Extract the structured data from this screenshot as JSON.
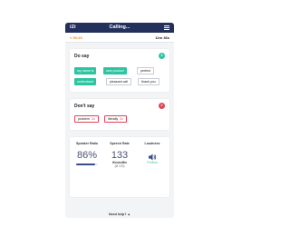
{
  "header": {
    "logo": "i2i",
    "title": "Calling...",
    "menu_icon": "hamburger-icon"
  },
  "subheader": {
    "back_label": "< 00:23",
    "duration": "12m 36s"
  },
  "do_say": {
    "title": "Do say",
    "count": "3",
    "count_color": "#2ec4a0",
    "chips": [
      {
        "label": "my name is",
        "state": "used"
      },
      {
        "label": "new product",
        "state": "used"
      },
      {
        "label": "perfect",
        "state": "unused"
      },
      {
        "label": "understand",
        "state": "used"
      },
      {
        "label": "pleasant call",
        "state": "unused"
      },
      {
        "label": "thank you",
        "state": "unused"
      }
    ]
  },
  "dont_say": {
    "title": "Don't say",
    "count": "2",
    "count_color": "#e04357",
    "chips": [
      {
        "label": "problem",
        "times": "2x"
      },
      {
        "label": "literally",
        "times": "2x"
      }
    ]
  },
  "metrics": {
    "speaker_ratio": {
      "label": "Speaker Ratio",
      "value": "86%",
      "level": 0.86
    },
    "speech_rate": {
      "label": "Speech Rate",
      "value": "133",
      "unit": "Words/Min",
      "average": "(Ø 120)"
    },
    "loudness": {
      "label": "Loudness",
      "icon": "speaker-icon",
      "status": "Perfect"
    }
  },
  "footer": {
    "help_label": "Need help? ▲"
  },
  "colors": {
    "navy": "#22305b",
    "accent_orange": "#e88a1a",
    "green": "#2ec4a0",
    "red": "#e04357"
  }
}
